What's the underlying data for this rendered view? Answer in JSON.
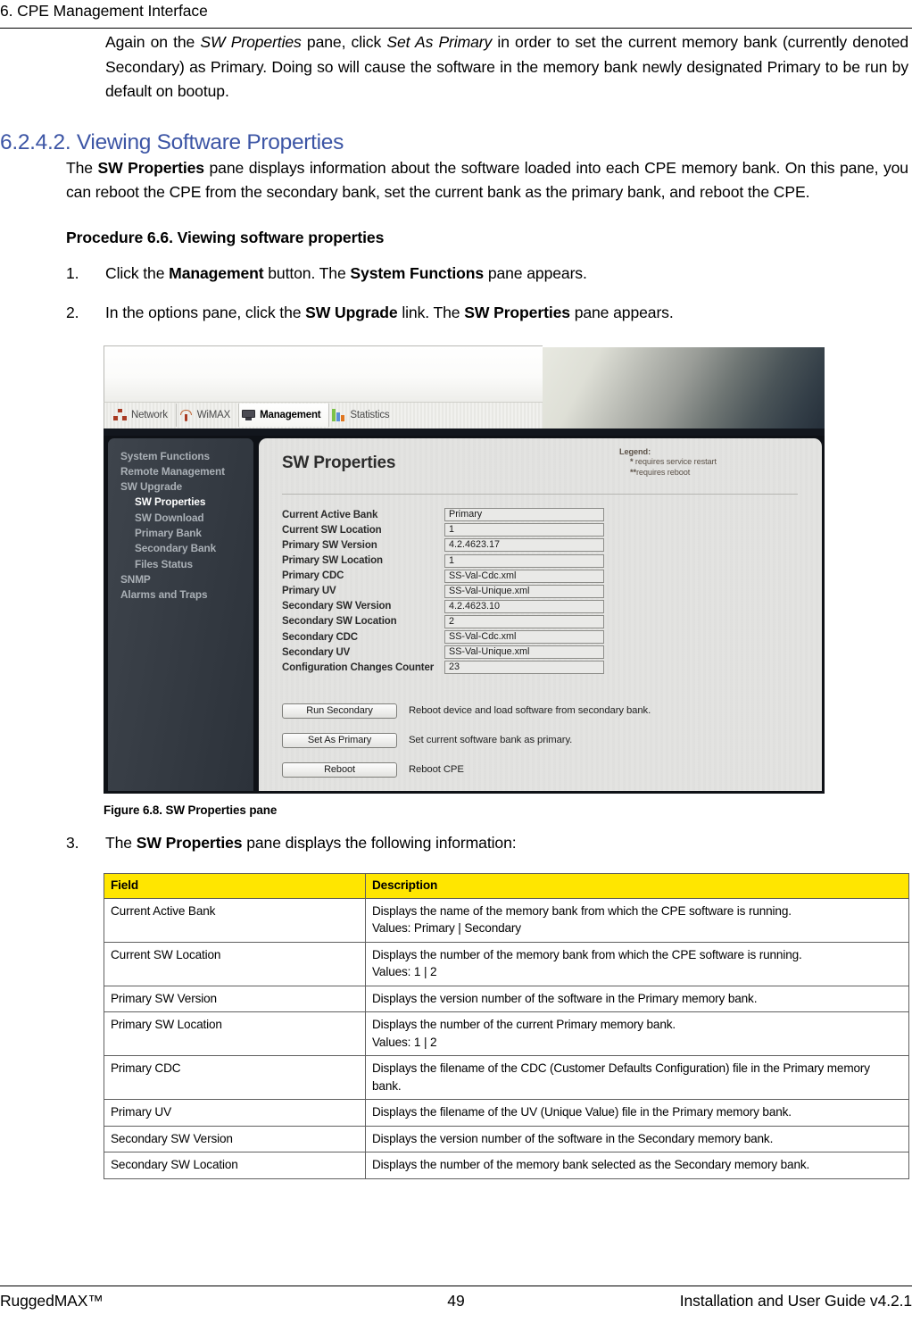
{
  "header": {
    "running_title": "6. CPE Management Interface"
  },
  "intro_paragraph": {
    "seg1": "Again on the ",
    "em1": "SW Properties",
    "seg2": " pane, click ",
    "em2": "Set As Primary",
    "seg3": " in order to set the current memory bank (currently denoted Secondary) as Primary. Doing so will cause the software in the memory bank newly designated Primary to be run by default on bootup."
  },
  "section": {
    "heading": "6.2.4.2. Viewing Software Properties",
    "description": {
      "seg1": "The ",
      "bold1": "SW Properties",
      "seg2": " pane displays information about the software loaded into each CPE memory bank. On this pane, you can reboot the CPE from the secondary bank, set the current bank as the primary bank, and reboot the CPE."
    },
    "procedure_heading": "Procedure 6.6. Viewing software properties"
  },
  "steps": [
    {
      "num": "1.",
      "seg1": "Click the ",
      "bold1": "Management",
      "seg2": " button. The ",
      "bold2": "System Functions",
      "seg3": " pane appears."
    },
    {
      "num": "2.",
      "seg1": "In the options pane, click the ",
      "bold1": "SW Upgrade",
      "seg2": " link. The ",
      "bold2": "SW Properties",
      "seg3": " pane appears."
    },
    {
      "num": "3.",
      "seg1": "The ",
      "bold1": "SW Properties",
      "seg2": " pane displays the following information:",
      "bold2": "",
      "seg3": ""
    }
  ],
  "figure": {
    "caption": "Figure 6.8. SW Properties pane",
    "screenshot": {
      "tabs": [
        {
          "label": "Network",
          "icon": "network-icon",
          "active": false
        },
        {
          "label": "WiMAX",
          "icon": "wimax-icon",
          "active": false
        },
        {
          "label": "Management",
          "icon": "management-icon",
          "active": true
        },
        {
          "label": "Statistics",
          "icon": "statistics-icon",
          "active": false
        }
      ],
      "sidebar": [
        {
          "label": "System Functions",
          "sub": false,
          "active": false
        },
        {
          "label": "Remote Management",
          "sub": false,
          "active": false
        },
        {
          "label": "SW Upgrade",
          "sub": false,
          "active": false
        },
        {
          "label": "SW Properties",
          "sub": true,
          "active": true
        },
        {
          "label": "SW Download",
          "sub": true,
          "active": false
        },
        {
          "label": "Primary Bank",
          "sub": true,
          "active": false
        },
        {
          "label": "Secondary Bank",
          "sub": true,
          "active": false
        },
        {
          "label": "Files Status",
          "sub": true,
          "active": false
        },
        {
          "label": "SNMP",
          "sub": false,
          "active": false
        },
        {
          "label": "Alarms and Traps",
          "sub": false,
          "active": false
        }
      ],
      "pane_title": "SW Properties",
      "legend": {
        "title": "Legend:",
        "items": [
          {
            "marker": "*",
            "text": " requires service restart"
          },
          {
            "marker": "**",
            "text": "requires reboot"
          }
        ]
      },
      "fields": [
        {
          "label": "Current Active Bank",
          "value": "Primary"
        },
        {
          "label": "Current SW Location",
          "value": "1"
        },
        {
          "label": "Primary SW Version",
          "value": "4.2.4623.17"
        },
        {
          "label": "Primary SW Location",
          "value": "1"
        },
        {
          "label": "Primary CDC",
          "value": "SS-Val-Cdc.xml"
        },
        {
          "label": "Primary UV",
          "value": "SS-Val-Unique.xml"
        },
        {
          "label": "Secondary SW Version",
          "value": "4.2.4623.10"
        },
        {
          "label": "Secondary SW Location",
          "value": "2"
        },
        {
          "label": "Secondary CDC",
          "value": "SS-Val-Cdc.xml"
        },
        {
          "label": "Secondary UV",
          "value": "SS-Val-Unique.xml"
        },
        {
          "label": "Configuration Changes Counter",
          "value": "23"
        }
      ],
      "actions": [
        {
          "button": "Run Secondary",
          "description": "Reboot device and load software from secondary bank."
        },
        {
          "button": "Set As Primary",
          "description": "Set current software bank as primary."
        },
        {
          "button": "Reboot",
          "description": "Reboot CPE"
        }
      ]
    }
  },
  "table": {
    "columns": [
      "Field",
      "Description"
    ],
    "rows": [
      {
        "field": "Current Active Bank",
        "description": "Displays the name of the memory bank from which the CPE software is running.\nValues: Primary | Secondary"
      },
      {
        "field": "Current SW Location",
        "description": "Displays the number of the memory bank from which the CPE software is running.\nValues: 1 | 2"
      },
      {
        "field": "Primary SW Version",
        "description": "Displays the version number of the software in the Primary memory bank."
      },
      {
        "field": "Primary SW Location",
        "description": "Displays the number of the current Primary memory bank.\nValues: 1 | 2"
      },
      {
        "field": "Primary CDC",
        "description": "Displays the filename of the CDC (Customer Defaults Configuration) file in the Primary memory bank."
      },
      {
        "field": "Primary UV",
        "description": "Displays the filename of the UV (Unique Value) file in the Primary memory bank."
      },
      {
        "field": "Secondary SW Version",
        "description": "Displays the version number of the software in the Secondary memory bank."
      },
      {
        "field": "Secondary SW Location",
        "description": "Displays the number of the memory bank selected as the Secondary memory bank."
      }
    ]
  },
  "footer": {
    "left": "RuggedMAX™",
    "page_number": "49",
    "right": "Installation and User Guide v4.2.1"
  },
  "colors": {
    "heading": "#3c55a5",
    "table_header_bg": "#ffe600",
    "sidebar_bg": "#363c44",
    "pane_bg": "#e3e3e1"
  }
}
